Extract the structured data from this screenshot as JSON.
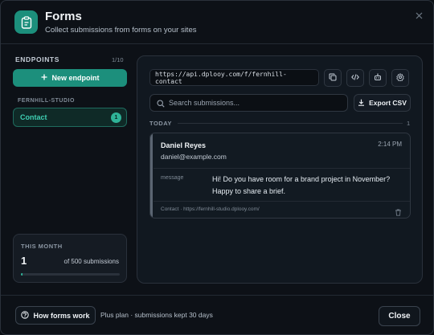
{
  "header": {
    "title": "Forms",
    "subtitle": "Collect submissions from forms on your sites",
    "icon": "clipboard-icon",
    "close_icon": "close-icon"
  },
  "sidebar": {
    "label": "ENDPOINTS",
    "count": "1/10",
    "new_button": "New endpoint",
    "group_label": "FERNHILL-STUDIO",
    "endpoints": [
      {
        "name": "Contact",
        "badge": "1"
      }
    ],
    "month": {
      "label": "THIS MONTH",
      "value": "1",
      "of_text": "of 500 submissions",
      "progress": 0.002
    }
  },
  "main": {
    "endpoint_url": "https://api.dplooy.com/f/fernhill-contact",
    "actions": [
      "copy-icon",
      "code-icon",
      "robot-icon",
      "settings-icon"
    ],
    "search": {
      "placeholder": "Search submissions...",
      "value": ""
    },
    "export_label": "Export CSV",
    "day_group": {
      "label": "TODAY",
      "count": "1"
    },
    "submissions": [
      {
        "name": "Daniel Reyes",
        "email": "daniel@example.com",
        "time": "2:14 PM",
        "field_key": "message",
        "message": "Hi! Do you have room for a brand project in November? Happy to share a brief.",
        "source": "Contact · https://fernhill-studio.dplooy.com/"
      }
    ]
  },
  "footer": {
    "help_button": "How forms work",
    "plan_text": "Plus plan · submissions kept 30 days",
    "close_button": "Close"
  },
  "colors": {
    "accent": "#1c8f7c",
    "accent_text": "#3fd0b3",
    "background": "#0d1117",
    "panel": "#111820"
  }
}
